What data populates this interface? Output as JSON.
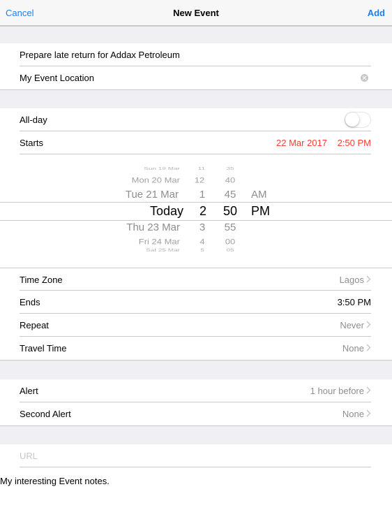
{
  "nav": {
    "cancel": "Cancel",
    "title": "New Event",
    "add": "Add"
  },
  "event": {
    "title_value": "Prepare late return for Addax Petroleum",
    "location_value": "My Event Location"
  },
  "all_day": {
    "label": "All-day",
    "on": false
  },
  "starts": {
    "label": "Starts",
    "date": "22 Mar 2017",
    "time": "2:50 PM"
  },
  "picker": {
    "days": [
      "Sun 19 Mar",
      "Mon 20 Mar",
      "Tue 21 Mar",
      "Today",
      "Thu 23 Mar",
      "Fri 24 Mar",
      "Sat 25 Mar"
    ],
    "hours": [
      "11",
      "12",
      "1",
      "2",
      "3",
      "4",
      "5"
    ],
    "minutes": [
      "35",
      "40",
      "45",
      "50",
      "55",
      "00",
      "05"
    ],
    "ampm": [
      "AM",
      "PM"
    ]
  },
  "time_zone": {
    "label": "Time Zone",
    "value": "Lagos"
  },
  "ends": {
    "label": "Ends",
    "value": "3:50 PM"
  },
  "repeat": {
    "label": "Repeat",
    "value": "Never"
  },
  "travel_time": {
    "label": "Travel Time",
    "value": "None"
  },
  "alert": {
    "label": "Alert",
    "value": "1 hour before"
  },
  "second_alert": {
    "label": "Second Alert",
    "value": "None"
  },
  "url": {
    "placeholder": "URL"
  },
  "notes": {
    "value": "My interesting Event notes."
  },
  "colors": {
    "accent": "#1f7ef0",
    "destructive": "#ff3b30",
    "separator": "#c8c7cc",
    "group_bg": "#efeff4",
    "secondary_text": "#8e8e93"
  }
}
